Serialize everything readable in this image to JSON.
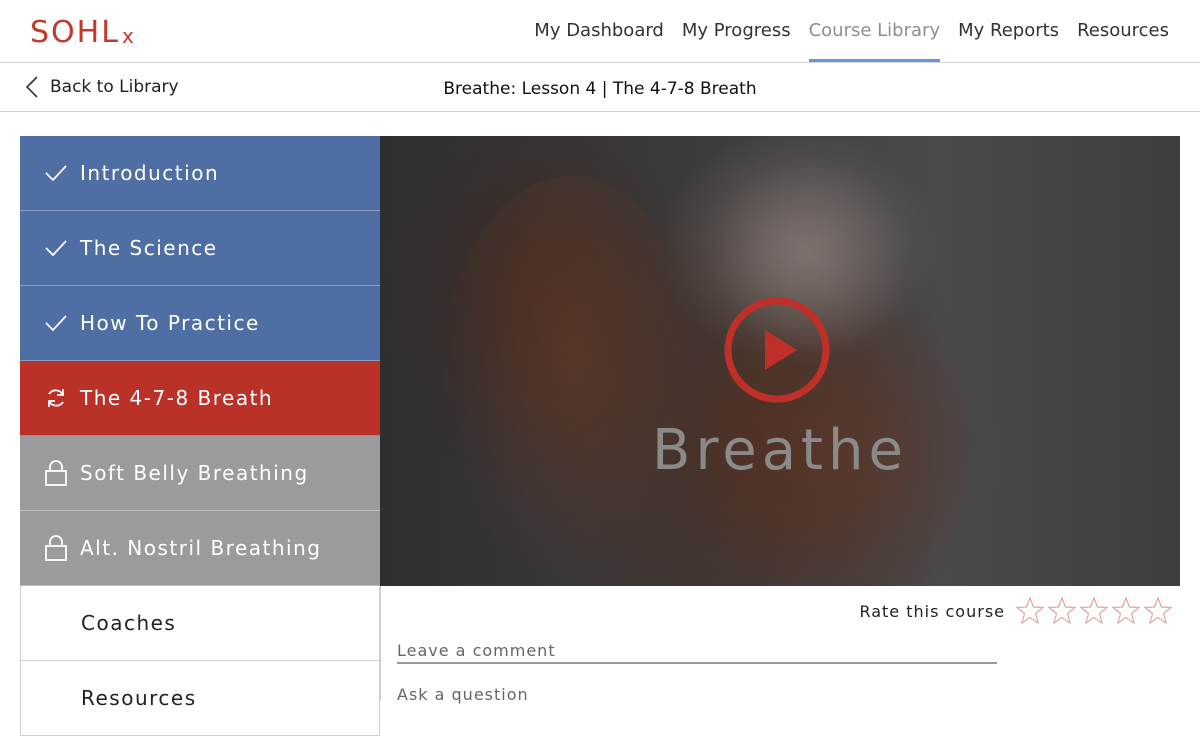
{
  "brand": {
    "logo_main": "SOHL",
    "logo_sub": "x",
    "color": "#c0392b"
  },
  "nav": {
    "items": [
      {
        "label": "My Dashboard",
        "active": false
      },
      {
        "label": "My Progress",
        "active": false
      },
      {
        "label": "Course Library",
        "active": true
      },
      {
        "label": "My Reports",
        "active": false
      },
      {
        "label": "Resources",
        "active": false
      }
    ],
    "accent": "#6b95d6"
  },
  "subheader": {
    "back_label": "Back to Library",
    "lesson_title": "Breathe: Lesson 4 | The 4-7-8 Breath"
  },
  "sidebar": {
    "items": [
      {
        "label": "Introduction",
        "status": "done",
        "icon": "check-icon"
      },
      {
        "label": "The Science",
        "status": "done",
        "icon": "check-icon"
      },
      {
        "label": "How To Practice",
        "status": "done",
        "icon": "check-icon"
      },
      {
        "label": "The 4-7-8 Breath",
        "status": "current",
        "icon": "refresh-icon"
      },
      {
        "label": "Soft Belly Breathing",
        "status": "locked",
        "icon": "lock-icon"
      },
      {
        "label": "Alt. Nostril Breathing",
        "status": "locked",
        "icon": "lock-icon"
      },
      {
        "label": "Coaches",
        "status": "plain",
        "icon": ""
      },
      {
        "label": "Resources",
        "status": "plain",
        "icon": ""
      }
    ],
    "colors": {
      "done": "#4f6ea4",
      "current": "#ba3128",
      "locked": "#9b9b9d"
    }
  },
  "video": {
    "title": "Breathe",
    "play_icon": "play-icon"
  },
  "feedback": {
    "rate_label": "Rate this course",
    "star_count": 5,
    "rating": 0,
    "comment_placeholder": "Leave a comment",
    "question_placeholder": "Ask a question"
  }
}
